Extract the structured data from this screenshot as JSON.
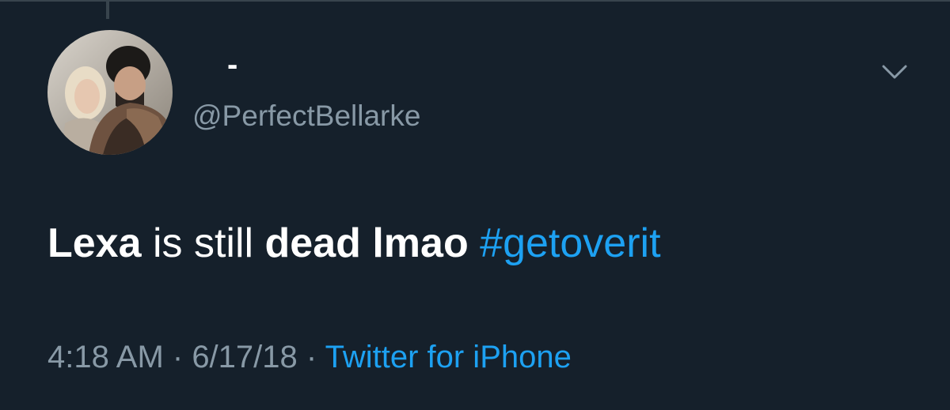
{
  "tweet": {
    "display_name": "-",
    "handle": "@PerfectBellarke",
    "text_parts": {
      "bold1": "Lexa",
      "normal1": " is still ",
      "bold2": "dead lmao",
      "space": " ",
      "hashtag": "#getoverit"
    },
    "time": "4:18 AM",
    "sep1": " · ",
    "date": "6/17/18",
    "sep2": " · ",
    "source": "Twitter for iPhone"
  },
  "icons": {
    "avatar": "profile-photo",
    "menu": "chevron-down-icon"
  },
  "colors": {
    "background": "#15202b",
    "link": "#1da1f2",
    "secondary_text": "#8899a6"
  }
}
